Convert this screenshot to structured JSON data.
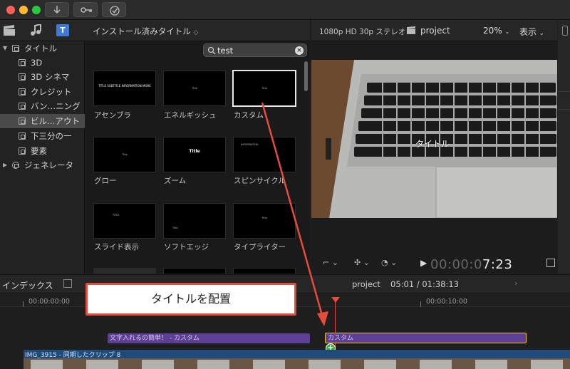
{
  "toolbar": {
    "traffic_lights": [
      "#fe5f57",
      "#febc2e",
      "#28c840"
    ]
  },
  "browser": {
    "title": "インストール済みタイトル",
    "search_value": "test"
  },
  "sidebar": {
    "items": [
      {
        "label": "タイトル"
      },
      {
        "label": "3D"
      },
      {
        "label": "3D シネマ"
      },
      {
        "label": "クレジット"
      },
      {
        "label": "バン…ニング"
      },
      {
        "label": "ビル…アウト"
      },
      {
        "label": "下三分の一"
      },
      {
        "label": "要素"
      },
      {
        "label": "ジェネレータ"
      }
    ]
  },
  "grid": {
    "items": [
      {
        "label": "アセンブラ",
        "preview": "TITLE SUBTITLE INFORMATION MORE"
      },
      {
        "label": "エネルギッシュ",
        "preview": "Title"
      },
      {
        "label": "カスタム",
        "preview": "Title"
      },
      {
        "label": "グロー",
        "preview": "Title"
      },
      {
        "label": "ズーム",
        "preview": "Title"
      },
      {
        "label": "スピンサイクル",
        "preview": "INFORMATION"
      },
      {
        "label": "スライド表示",
        "preview": "TITLE"
      },
      {
        "label": "ソフトエッジ",
        "preview": "Title"
      },
      {
        "label": "タイプライター",
        "preview": "Title"
      }
    ]
  },
  "viewer": {
    "format": "1080p HD 30p ステレオ",
    "project": "project",
    "zoom": "20%",
    "view_menu": "表示",
    "caption": "タイトル",
    "timecode_dim": "00:00:0",
    "timecode_bright": "7:23"
  },
  "timeline": {
    "index_label": "インデックス",
    "project": "project",
    "duration": "05:01 / 01:38:13",
    "ruler_start": "00:00:00:00",
    "ruler_mid": "00:00:10:00",
    "clip_title_1": "文字入れるの簡単！ - カスタム",
    "clip_title_2": "カスタム",
    "storyline_label": "IMG_3915 - 同期したクリップ 8"
  },
  "annotation": {
    "callout": "タイトルを配置",
    "arrow_color": "#e54c3c"
  }
}
